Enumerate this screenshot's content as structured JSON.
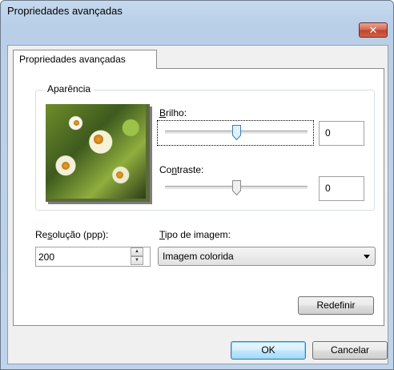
{
  "window": {
    "title": "Propriedades avançadas",
    "close_glyph": "✕"
  },
  "tab": {
    "label": "Propriedades avançadas"
  },
  "appearance": {
    "legend": "Aparência",
    "preview_icon": "flowers-photo-icon",
    "brightness": {
      "label_underlined": "B",
      "label_rest": "rilho:",
      "value": "0",
      "level": 0.5
    },
    "contrast": {
      "label_pre": "Co",
      "label_underlined": "n",
      "label_rest": "traste:",
      "value": "0",
      "level": 0.5
    }
  },
  "resolution": {
    "label_pre": "Re",
    "label_underlined": "s",
    "label_rest": "olução (ppp):",
    "value": "200"
  },
  "image_type": {
    "label_underlined": "T",
    "label_rest": "ipo de imagem:",
    "selected": "Imagem colorida"
  },
  "buttons": {
    "reset": "Redefinir",
    "ok": "OK",
    "cancel": "Cancelar"
  }
}
